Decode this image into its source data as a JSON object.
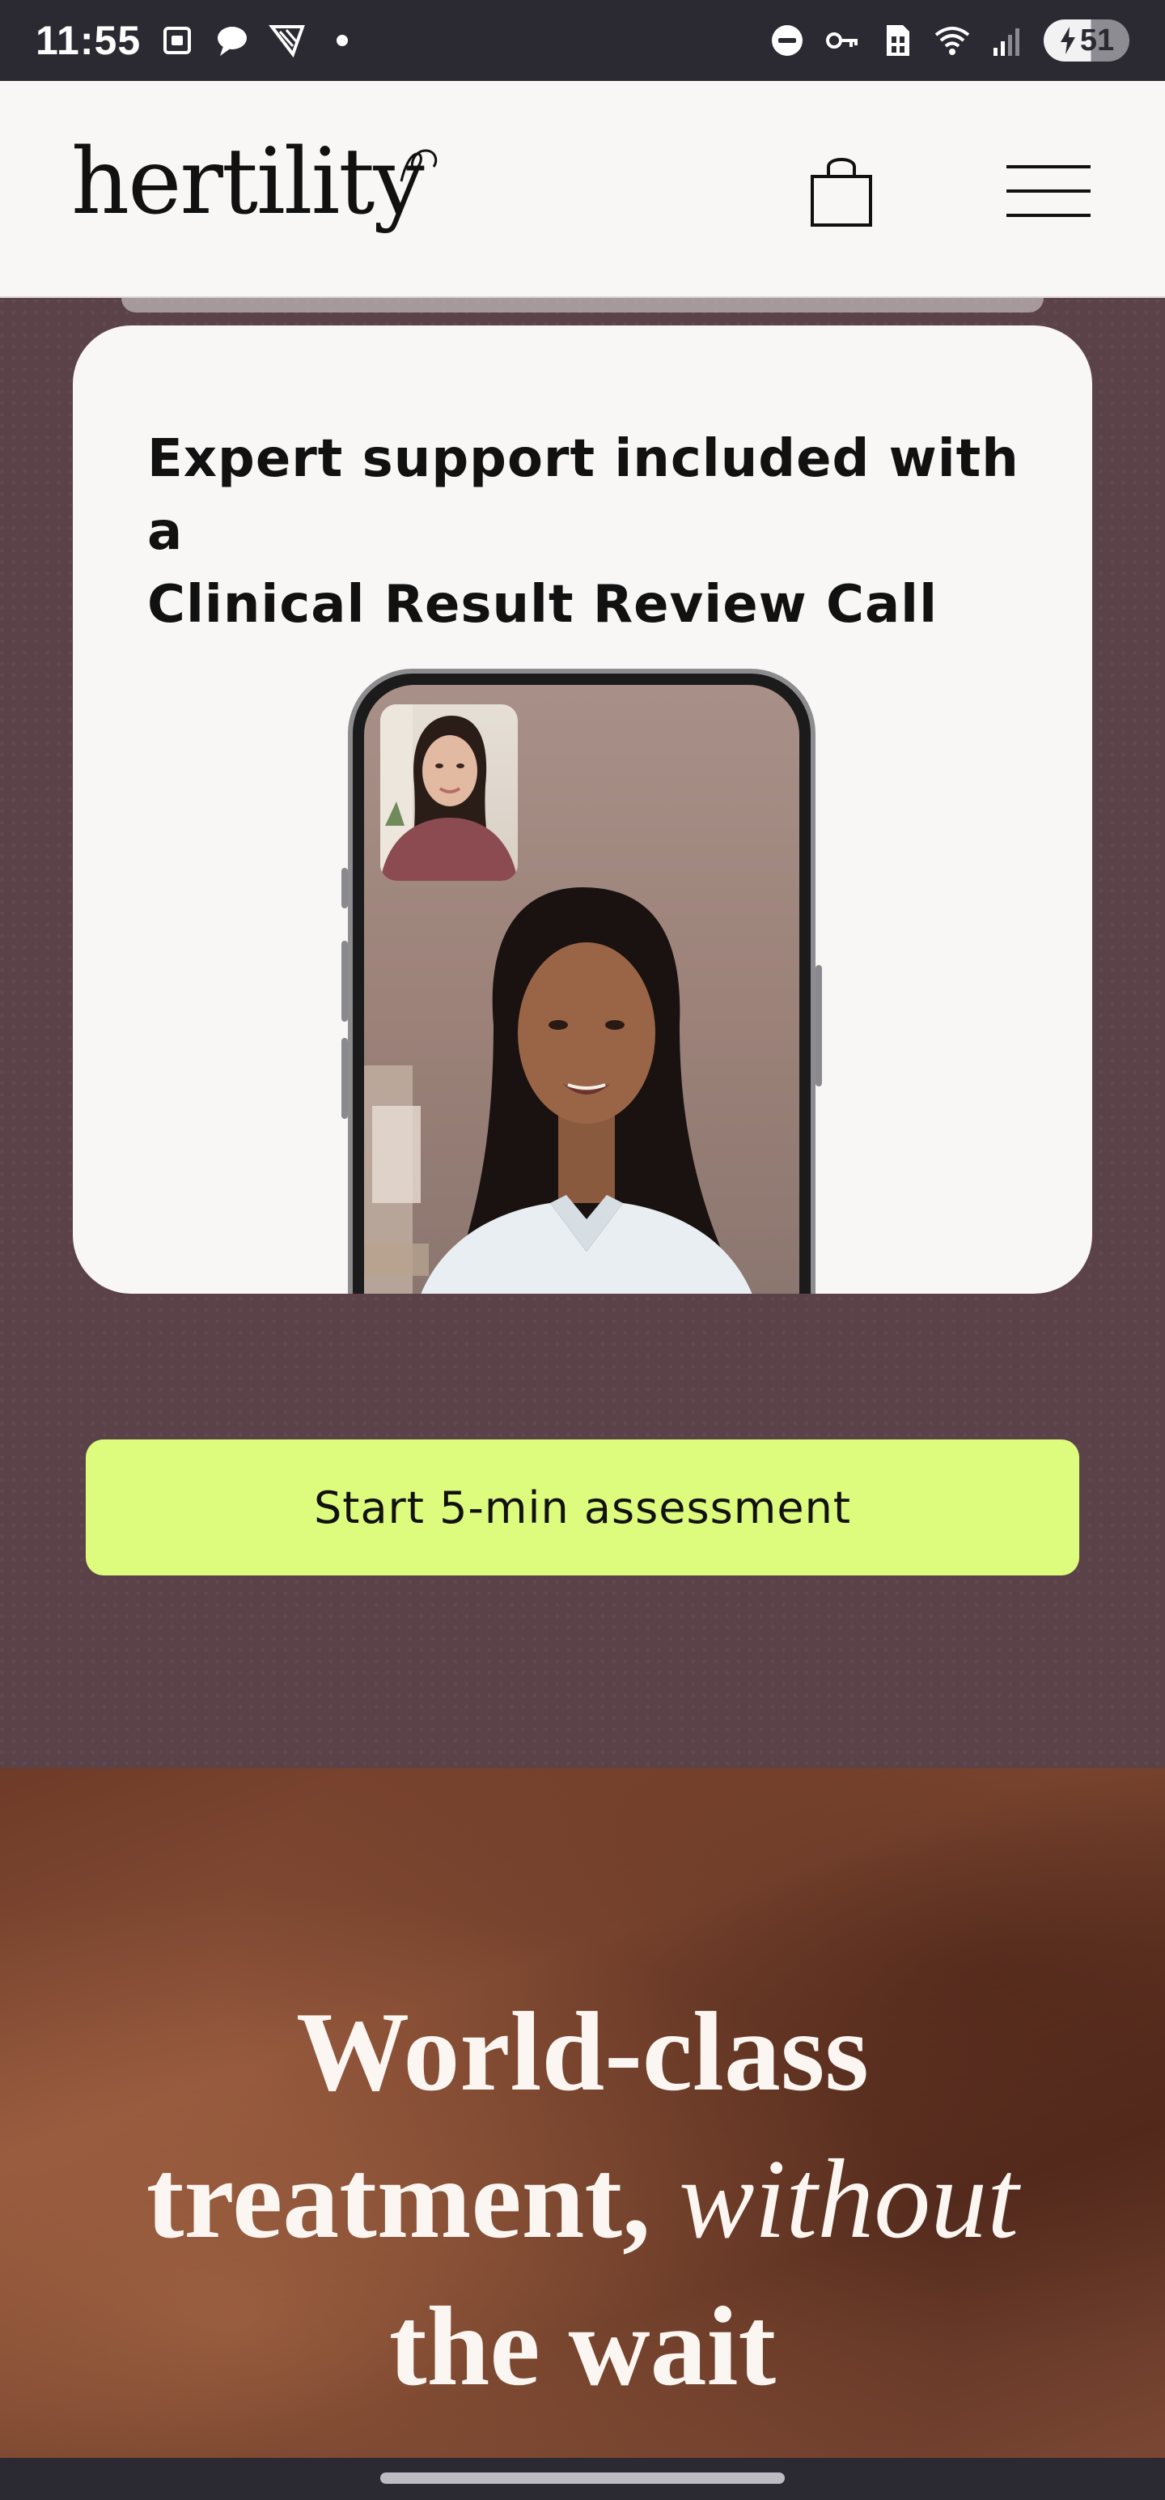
{
  "status_bar": {
    "time": "11:55",
    "battery_level": "51",
    "left_icons": [
      "screenshot-icon",
      "chat-bubble-icon",
      "ryanair-icon",
      "dot-icon"
    ],
    "right_icons": [
      "do-not-disturb-icon",
      "vpn-key-icon",
      "sim-icon",
      "wifi-icon",
      "signal-icon",
      "battery-charging-icon"
    ]
  },
  "header": {
    "logo_text": "hertility",
    "cart_icon": "shopping-bag-icon",
    "menu_icon": "hamburger-menu-icon"
  },
  "feature_card": {
    "title_line1": "Expert support included with a",
    "title_line2": "Clinical Result Review Call"
  },
  "cta": {
    "label": "Start 5-min assessment"
  },
  "hero": {
    "line1": "World-class",
    "line2_plain": "treatment, ",
    "line2_italic": "without",
    "line3": "the wait"
  },
  "colors": {
    "header_bg": "#f8f7f5",
    "section_bg": "#5b4249",
    "cta_bg": "#ddfb7d",
    "hero_text": "#fbf6f1"
  }
}
